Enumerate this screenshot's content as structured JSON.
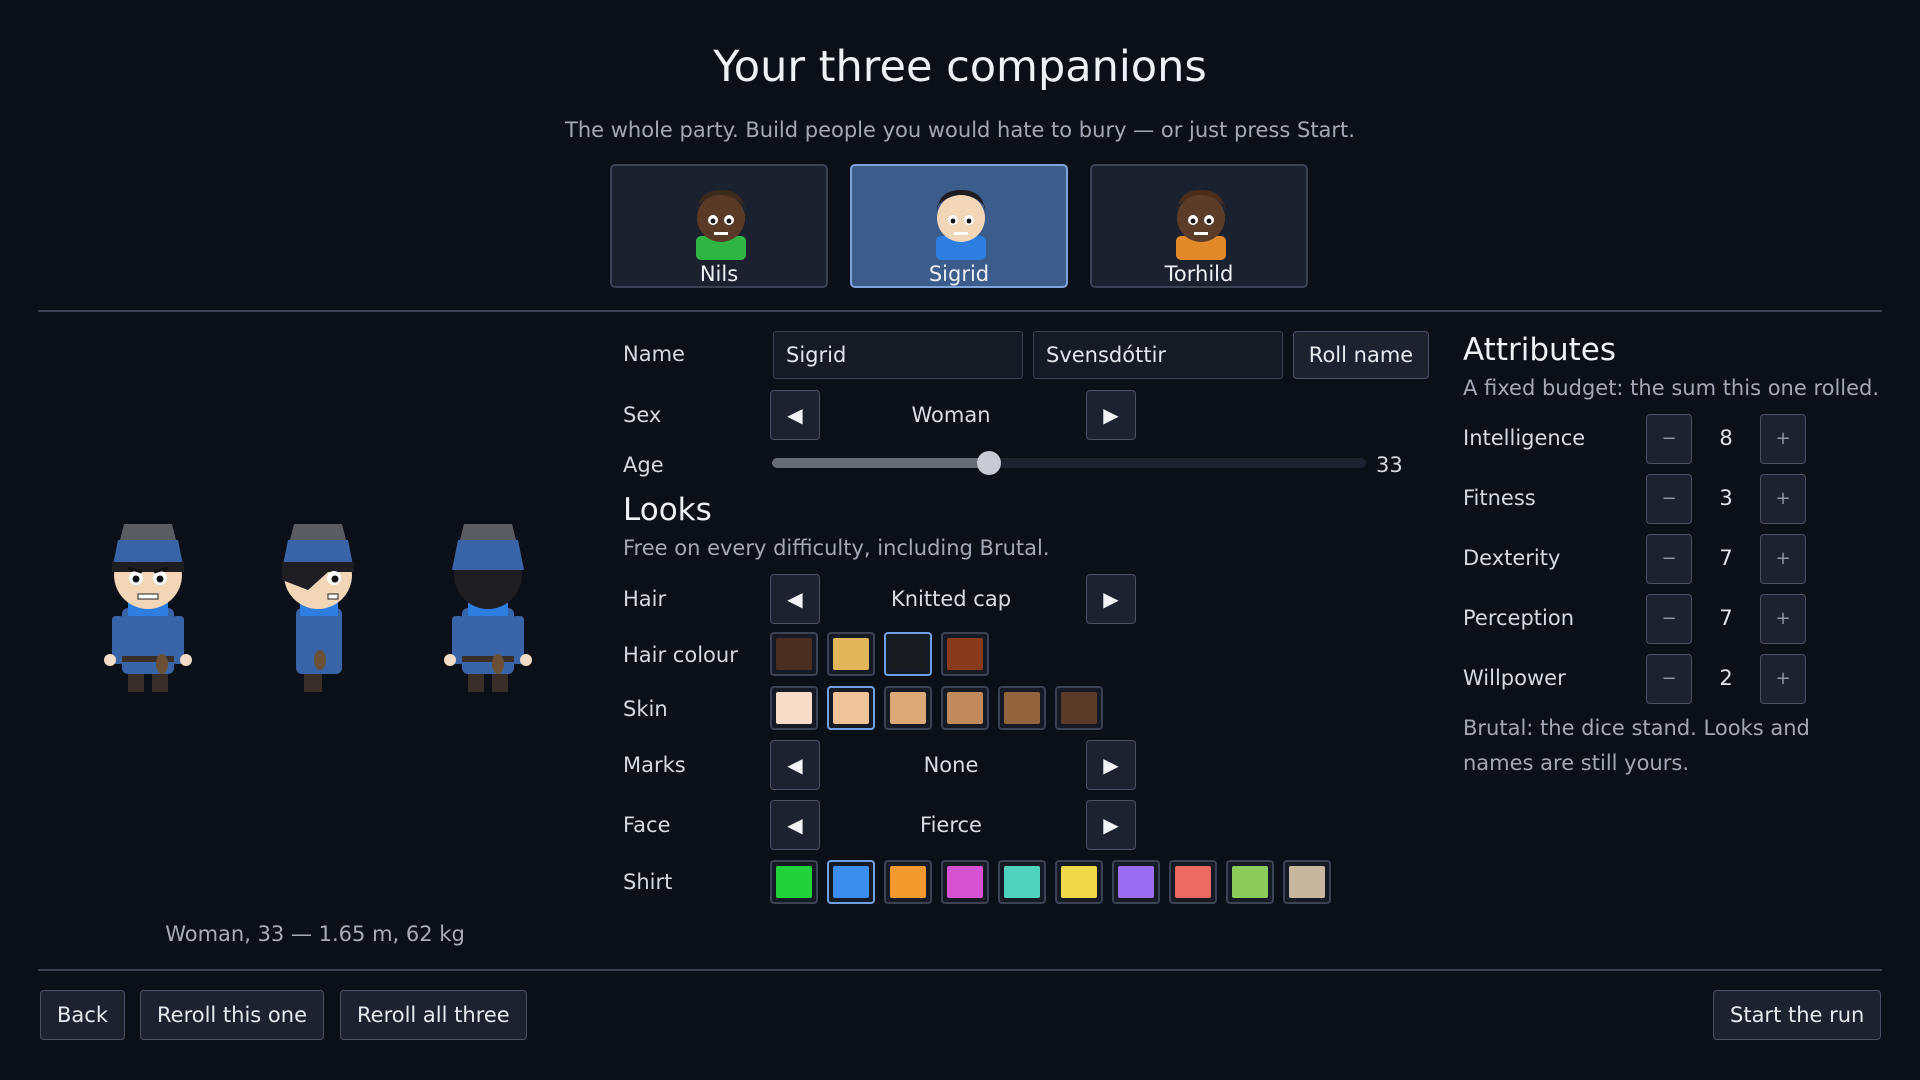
{
  "header": {
    "title": "Your three companions",
    "subtitle": "The whole party. Build people you would hate to bury — or just press Start."
  },
  "companions": [
    {
      "name": "Nils",
      "selected": false,
      "skin": "#5a3a26",
      "hair": "#3d2a1c",
      "shirt": "#2fb544"
    },
    {
      "name": "Sigrid",
      "selected": true,
      "skin": "#f3d6b8",
      "hair": "#1d1d22",
      "shirt": "#2e7de0"
    },
    {
      "name": "Torhild",
      "selected": false,
      "skin": "#5a3c28",
      "hair": "#4a2e1b",
      "shirt": "#e2892a"
    }
  ],
  "preview": {
    "caption": "Woman, 33 — 1.65 m, 62 kg"
  },
  "form": {
    "name_label": "Name",
    "first_name": "Sigrid",
    "last_name": "Svensdóttir",
    "roll_name_label": "Roll name",
    "sex_label": "Sex",
    "sex_value": "Woman",
    "age_label": "Age",
    "age_value": "33",
    "age_fraction": 0.365,
    "prev_icon": "left-arrow",
    "next_icon": "right-arrow"
  },
  "looks": {
    "title": "Looks",
    "note": "Free on every difficulty, including Brutal.",
    "hair_label": "Hair",
    "hair_value": "Knitted cap",
    "hair_colour_label": "Hair colour",
    "hair_colours": [
      "#4a2e22",
      "#e2b65a",
      "#1a1b20",
      "#8a3a1c"
    ],
    "hair_colour_selected": 2,
    "skin_label": "Skin",
    "skin_colours": [
      "#f8dcc8",
      "#efc49a",
      "#dba878",
      "#c08a5c",
      "#94643f",
      "#5c3a28"
    ],
    "skin_selected": 1,
    "marks_label": "Marks",
    "marks_value": "None",
    "face_label": "Face",
    "face_value": "Fierce",
    "shirt_label": "Shirt",
    "shirt_colours": [
      "#22d13c",
      "#3b8eee",
      "#f39a2e",
      "#d553d3",
      "#4fd3bd",
      "#f0d84a",
      "#9b6df0",
      "#ec6a62",
      "#8ccc5a",
      "#c7b79e"
    ],
    "shirt_selected": 1
  },
  "attributes": {
    "title": "Attributes",
    "note": "A fixed budget: the sum this one rolled.",
    "minus": "−",
    "plus": "+",
    "items": [
      {
        "label": "Intelligence",
        "value": "8"
      },
      {
        "label": "Fitness",
        "value": "3"
      },
      {
        "label": "Dexterity",
        "value": "7"
      },
      {
        "label": "Perception",
        "value": "7"
      },
      {
        "label": "Willpower",
        "value": "2"
      }
    ],
    "footer_line1": "Brutal: the dice stand. Looks and",
    "footer_line2": "names are still yours."
  },
  "footer": {
    "back": "Back",
    "reroll_one": "Reroll this one",
    "reroll_all": "Reroll all three",
    "start": "Start the run"
  }
}
